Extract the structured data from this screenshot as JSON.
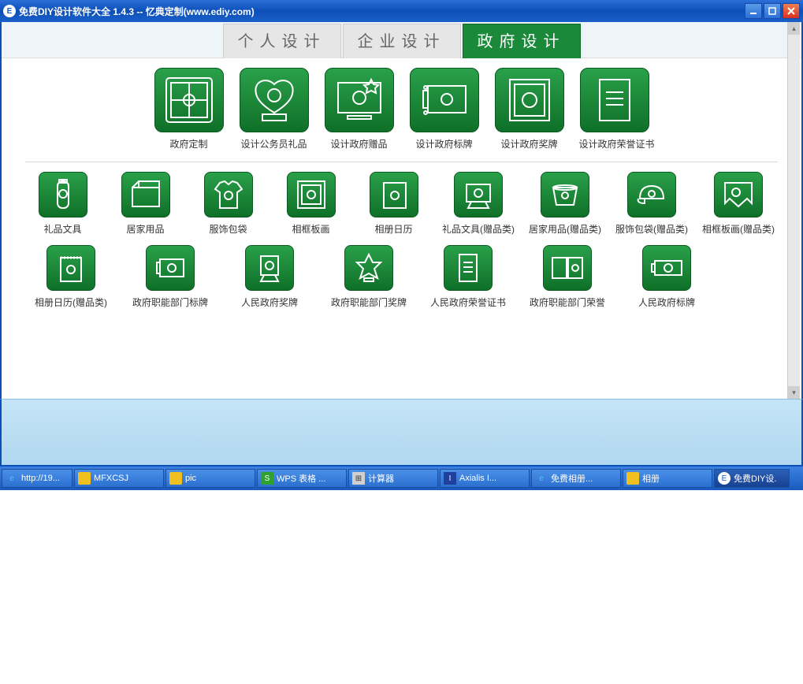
{
  "window": {
    "title": "免费DIY设计软件大全  1.4.3 -- 忆典定制(www.ediy.com)",
    "icon_letter": "E"
  },
  "tabs": [
    {
      "label": "个人设计",
      "active": false
    },
    {
      "label": "企业设计",
      "active": false
    },
    {
      "label": "政府设计",
      "active": true
    }
  ],
  "row1": [
    {
      "label": "政府定制"
    },
    {
      "label": "设计公务员礼品"
    },
    {
      "label": "设计政府赠品"
    },
    {
      "label": "设计政府标牌"
    },
    {
      "label": "设计政府奖牌"
    },
    {
      "label": "设计政府荣誉证书"
    }
  ],
  "row2": [
    {
      "label": "礼品文具"
    },
    {
      "label": "居家用品"
    },
    {
      "label": "服饰包袋"
    },
    {
      "label": "相框板画"
    },
    {
      "label": "相册日历"
    },
    {
      "label": "礼品文具(赠品类)"
    },
    {
      "label": "居家用品(赠品类)"
    },
    {
      "label": "服饰包袋(赠品类)"
    },
    {
      "label": "相框板画(赠品类)"
    }
  ],
  "row3": [
    {
      "label": "相册日历(赠品类)"
    },
    {
      "label": "政府职能部门标牌"
    },
    {
      "label": "人民政府奖牌"
    },
    {
      "label": "政府职能部门奖牌"
    },
    {
      "label": "人民政府荣誉证书"
    },
    {
      "label": "政府职能部门荣誉"
    },
    {
      "label": "人民政府标牌"
    }
  ],
  "taskbar": [
    {
      "label": "http://19...",
      "icon": "ie",
      "active": false
    },
    {
      "label": "MFXCSJ",
      "icon": "folder",
      "active": false
    },
    {
      "label": "pic",
      "icon": "folder",
      "active": false
    },
    {
      "label": "WPS 表格 ...",
      "icon": "wps",
      "active": false
    },
    {
      "label": "计算器",
      "icon": "calc",
      "active": false
    },
    {
      "label": "Axialis I...",
      "icon": "axialis",
      "active": false
    },
    {
      "label": "免费相册...",
      "icon": "ie",
      "active": false
    },
    {
      "label": "相册",
      "icon": "folder",
      "active": false
    },
    {
      "label": "免费DIY设.",
      "icon": "app",
      "active": true
    }
  ]
}
